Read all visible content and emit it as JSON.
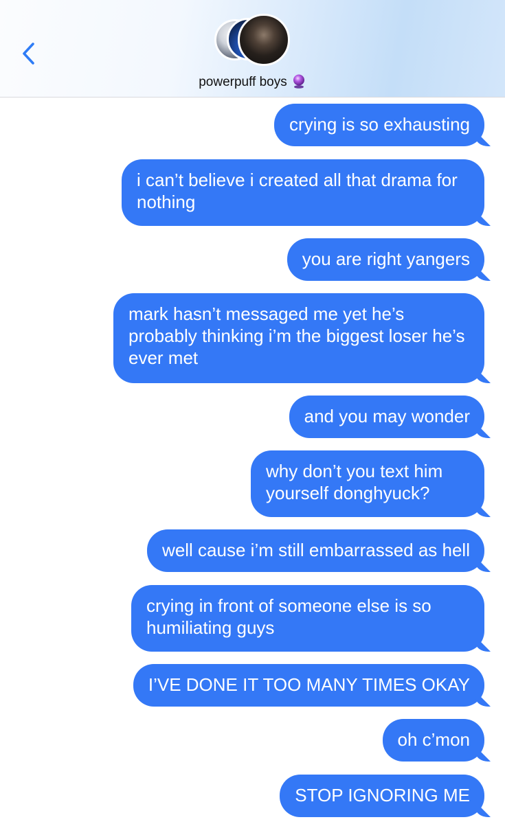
{
  "header": {
    "group_name": "powerpuff boys",
    "group_emoji": "crystal-ball-icon"
  },
  "colors": {
    "bubble": "#3478f6",
    "back_chevron": "#2f7cf6"
  },
  "messages": [
    {
      "text": "crying is so exhausting"
    },
    {
      "text": "i can’t believe i created all that drama for nothing"
    },
    {
      "text": "you are right yangers"
    },
    {
      "text": "mark hasn’t messaged me yet he’s probably thinking i’m the biggest loser he’s ever met"
    },
    {
      "text": "and you may wonder"
    },
    {
      "text": "why don’t you text him yourself donghyuck?"
    },
    {
      "text": "well cause i’m still embarrassed as hell"
    },
    {
      "text": "crying in front of someone else is so humiliating guys"
    },
    {
      "text": "I’VE DONE IT TOO MANY TIMES OKAY"
    },
    {
      "text": "oh c’mon"
    },
    {
      "text": "STOP IGNORING ME"
    }
  ]
}
